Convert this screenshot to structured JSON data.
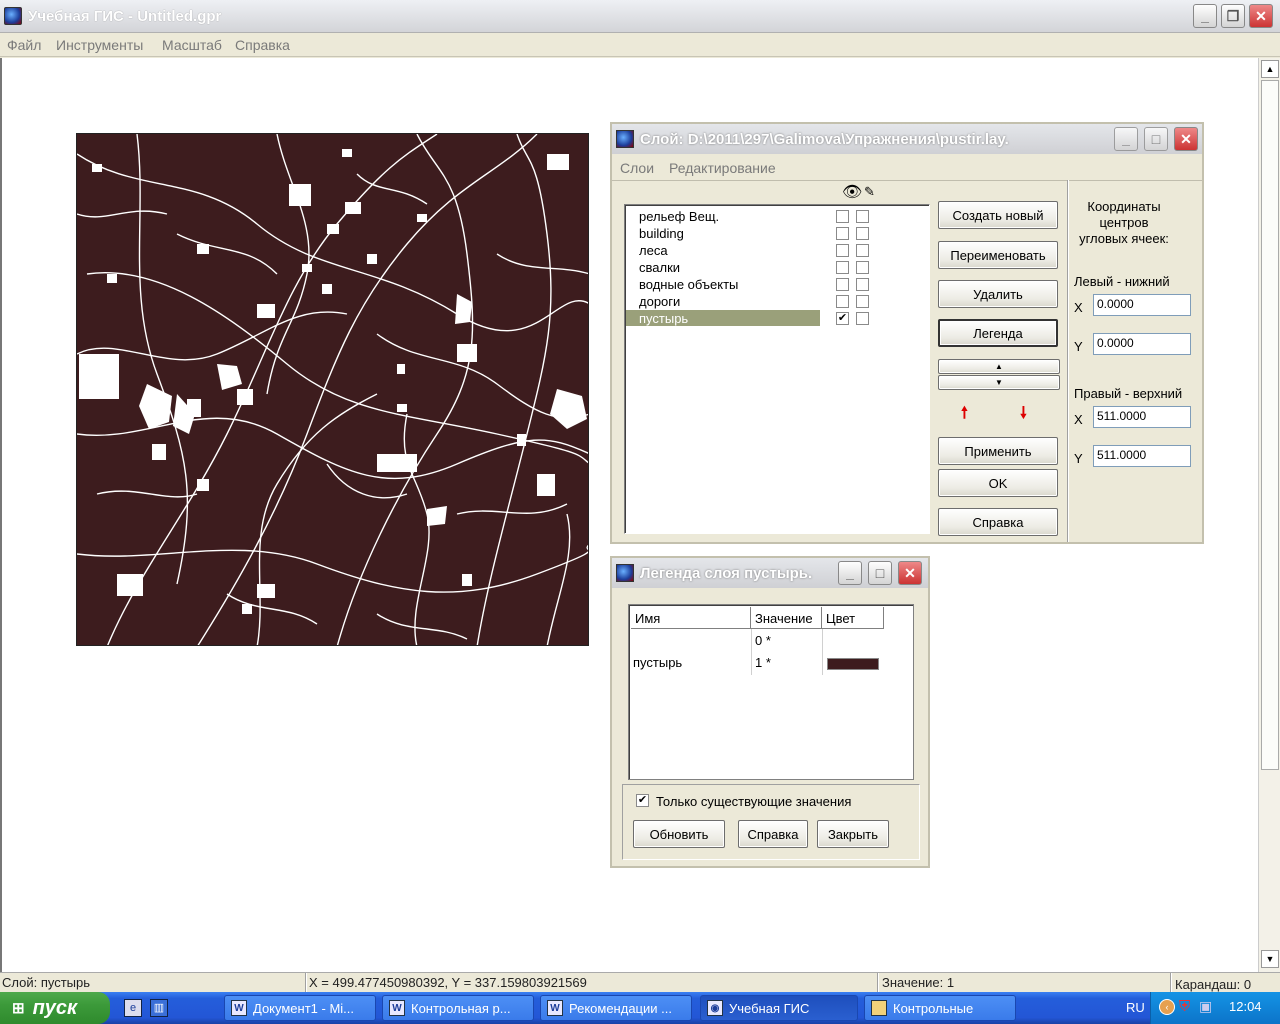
{
  "app": {
    "title": "Учебная ГИС - Untitled.gpr",
    "menu": [
      "Файл",
      "Инструменты",
      "Масштаб",
      "Справка"
    ]
  },
  "colors": {
    "map_bg": "#3d1c1e",
    "legend_swatch": "#3d1c1e",
    "selected_row": "#9aa07a"
  },
  "layer_dialog": {
    "title": "Слой: D:\\2011\\297\\Galimova\\Упражнения\\pustir.lay.",
    "menu": [
      "Слои",
      "Редактирование"
    ],
    "layers": [
      {
        "name": "рельеф Вещ.",
        "visible": false,
        "edit": false
      },
      {
        "name": "building",
        "visible": false,
        "edit": false
      },
      {
        "name": "леса",
        "visible": false,
        "edit": false
      },
      {
        "name": "свалки",
        "visible": false,
        "edit": false
      },
      {
        "name": "водные объекты",
        "visible": false,
        "edit": false
      },
      {
        "name": "дороги",
        "visible": false,
        "edit": false
      },
      {
        "name": "пустырь",
        "visible": true,
        "edit": false,
        "selected": true
      }
    ],
    "buttons": {
      "create": "Создать новый",
      "rename": "Переименовать",
      "delete": "Удалить",
      "legend": "Легенда",
      "apply": "Применить",
      "ok": "OK",
      "help": "Справка"
    },
    "coords": {
      "heading": "Координаты центров угловых ячеек:",
      "lower_left": "Левый - нижний",
      "upper_right": "Правый - верхний",
      "x_label": "X",
      "y_label": "Y",
      "ll_x": "0.0000",
      "ll_y": "0.0000",
      "ur_x": "511.0000",
      "ur_y": "511.0000"
    }
  },
  "legend_dialog": {
    "title": "Легенда слоя пустырь.",
    "columns": [
      "Имя",
      "Значение",
      "Цвет"
    ],
    "rows": [
      {
        "name": "",
        "value": "0 *"
      },
      {
        "name": "пустырь",
        "value": "1 *"
      }
    ],
    "only_existing": "Только существующие значения",
    "buttons": {
      "refresh": "Обновить",
      "help": "Справка",
      "close": "Закрыть"
    }
  },
  "status": {
    "layer": "Слой: пустырь",
    "coords": "X = 499.477450980392, Y = 337.159803921569",
    "value": "Значение: 1",
    "tool": "Карандаш: 0"
  },
  "taskbar": {
    "start": "пуск",
    "tasks": [
      "Документ1 - Mi...",
      "Контрольная р...",
      "Рекомендации ...",
      "Учебная ГИС",
      "Контрольные"
    ],
    "lang": "RU",
    "clock": "12:04"
  }
}
